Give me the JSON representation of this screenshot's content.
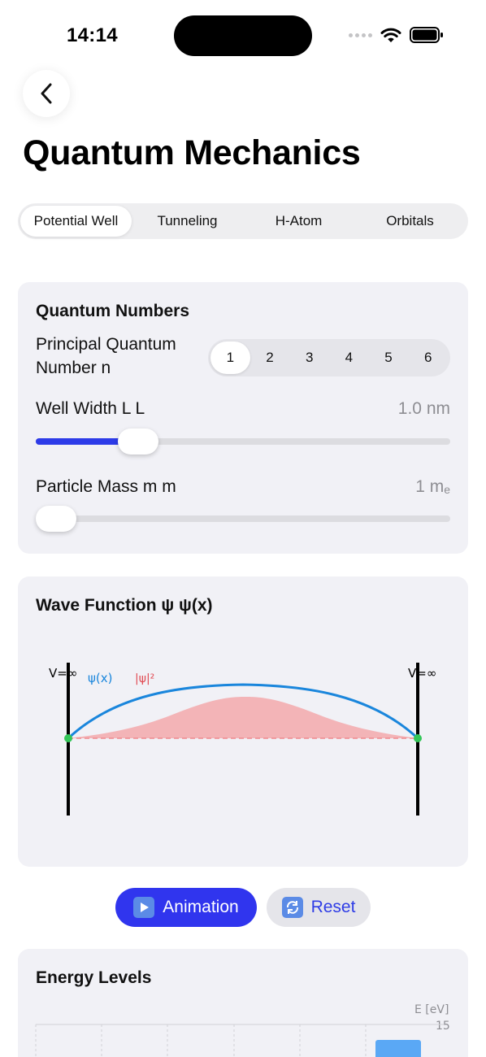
{
  "status": {
    "time": "14:14"
  },
  "header": {
    "title": "Quantum Mechanics"
  },
  "tabs": [
    "Potential Well",
    "Tunneling",
    "H-Atom",
    "Orbitals"
  ],
  "quantum_numbers": {
    "title": "Quantum Numbers",
    "principal_label": "Principal Quantum Number n",
    "n_options": [
      "1",
      "2",
      "3",
      "4",
      "5",
      "6"
    ],
    "selected_n": "1",
    "width_label": "Well Width L L",
    "width_value": "1.0 nm",
    "width_fraction": 0.22,
    "mass_label": "Particle Mass m m",
    "mass_value": "1 m",
    "mass_unit_sub": "e",
    "mass_fraction": 0.0
  },
  "wave_function": {
    "title": "Wave Function ψ ψ(x)",
    "left_wall_label": "V=∞",
    "right_wall_label": "V=∞",
    "psi_legend": "ψ(x)",
    "prob_legend": "|ψ|²",
    "colors": {
      "psi": "#1a86dc",
      "prob": "#f4a5a8",
      "prob_text": "#e14a52",
      "node": "#34c759"
    }
  },
  "actions": {
    "animation_label": "Animation",
    "animation_icon": "▶️",
    "reset_label": "Reset",
    "reset_icon": "🔄"
  },
  "energy_levels": {
    "title": "Energy Levels",
    "axis_label": "E [eV]",
    "axis_max": "15"
  },
  "colors": {
    "accent": "#2d3be8",
    "card_bg": "#f1f1f6"
  }
}
